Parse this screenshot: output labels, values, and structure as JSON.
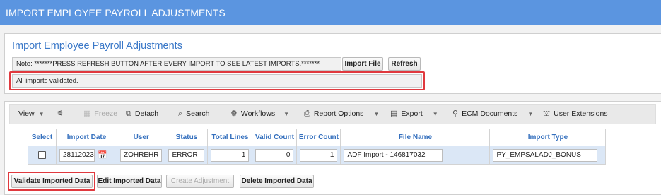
{
  "window": {
    "title": "IMPORT EMPLOYEE PAYROLL ADJUSTMENTS"
  },
  "import_panel": {
    "title": "Import Employee Payroll Adjustments",
    "note": "Note: *******PRESS REFRESH BUTTON AFTER EVERY IMPORT TO SEE LATEST IMPORTS.*******",
    "import_file_label": "Import File",
    "refresh_label": "Refresh",
    "status": "All imports validated."
  },
  "toolbar": {
    "view": "View",
    "freeze": "Freeze",
    "detach": "Detach",
    "search": "Search",
    "workflows": "Workflows",
    "report_options": "Report Options",
    "export": "Export",
    "ecm_documents": "ECM Documents",
    "user_extensions": "User Extensions"
  },
  "grid": {
    "headers": [
      "Select",
      "Import Date",
      "User",
      "Status",
      "Total Lines",
      "Valid Count",
      "Error Count",
      "File Name",
      "Import Type"
    ],
    "row": {
      "import_date": "28112023",
      "user": "ZOHREHR",
      "status": "ERROR",
      "total_lines": "1",
      "valid_count": "0",
      "error_count": "1",
      "file_name": "ADF Import - 146817032",
      "import_type": "PY_EMPSALADJ_BONUS"
    }
  },
  "actions": {
    "validate": "Validate Imported Data",
    "edit": "Edit Imported Data",
    "create": "Create Adjustment",
    "delete": "Delete Imported Data"
  },
  "colors": {
    "title_bar": "#5b95e0",
    "highlight": "#e0393e",
    "header_text": "#3570be"
  }
}
